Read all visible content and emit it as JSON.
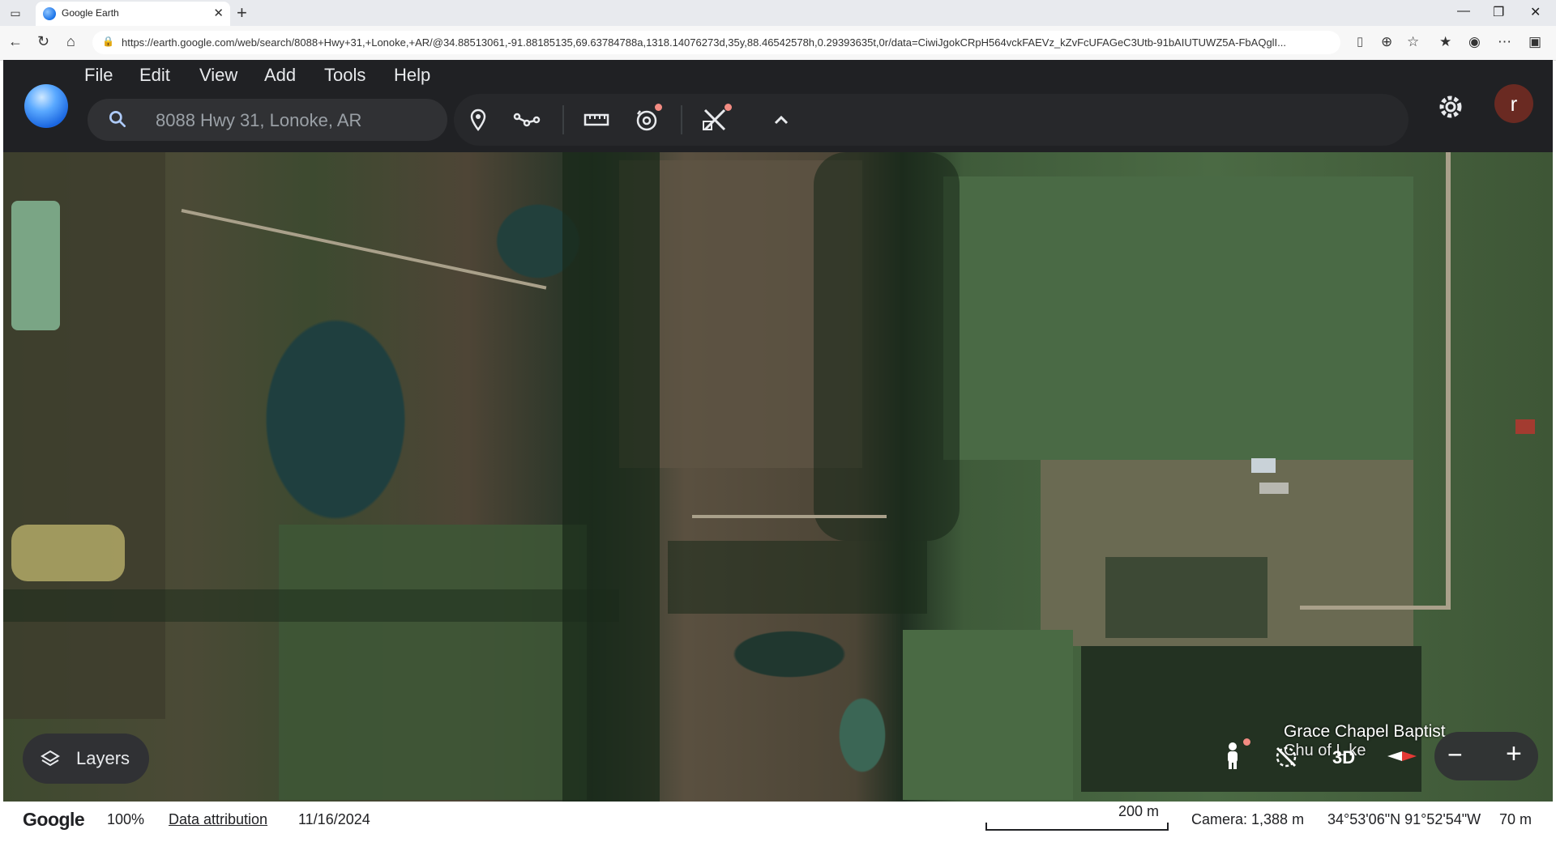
{
  "browser": {
    "tab_title": "Google Earth",
    "url": "https://earth.google.com/web/search/8088+Hwy+31,+Lonoke,+AR/@34.88513061,-91.88185135,69.63784788a,1318.14076273d,35y,88.46542578h,0.29393635t,0r/data=CiwiJgokCRpH564vckFAEVz_kZvFcUFAGeC3Utb-91bAIUTUWZ5A-FbAQglI..."
  },
  "app": {
    "menu": [
      "File",
      "Edit",
      "View",
      "Add",
      "Tools",
      "Help"
    ],
    "search": {
      "placeholder": "8088 Hwy 31, Lonoke, AR"
    },
    "avatar_letter": "r",
    "place_label": "Grace Chapel Baptist",
    "place_label_partial": "Chu      of L      ke",
    "layers_label": "Layers",
    "view_mode": "3D"
  },
  "status": {
    "google": "Google",
    "zoom": "100%",
    "attribution": "Data attribution",
    "date": "11/16/2024",
    "scale": "200 m",
    "camera": "Camera: 1,388 m",
    "coords": "34°53'06\"N 91°52'54\"W",
    "elevation": "70 m"
  },
  "colors": {
    "app_bg": "#202124",
    "panel": "#303134",
    "accent": "#1a73e8",
    "notify_dot": "#f28b82"
  },
  "icons": [
    "search-icon",
    "placemark-icon",
    "path-icon",
    "ruler-icon",
    "history-icon",
    "projects-icon",
    "chevron-up-icon",
    "gear-icon",
    "layers-icon",
    "pegman-icon",
    "compass-icon",
    "zoom-in-icon",
    "zoom-out-icon"
  ]
}
